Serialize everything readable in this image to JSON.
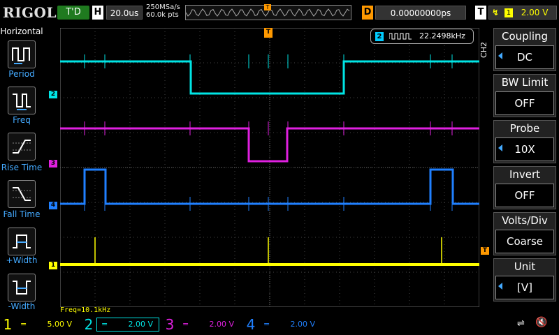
{
  "brand": "RIGOL",
  "top": {
    "trigger_status": "T'D",
    "h_label": "H",
    "timebase": "20.0us",
    "sample_rate": "250MSa/s",
    "mem_depth": "60.0k pts",
    "d_label": "D",
    "delay": "0.00000000ps",
    "t_label": "T",
    "trigger_edge_icon": "rising-edge-icon",
    "trigger_source": "1",
    "trigger_level": "2.00 V",
    "memory_marker": "T"
  },
  "left_panel": {
    "title": "Horizontal",
    "items": [
      {
        "label": "Period",
        "icon": "period-icon"
      },
      {
        "label": "Freq",
        "icon": "freq-icon"
      },
      {
        "label": "Rise Time",
        "icon": "rise-time-icon"
      },
      {
        "label": "Fall Time",
        "icon": "fall-time-icon"
      },
      {
        "label": "+Width",
        "icon": "pos-width-icon"
      },
      {
        "label": "-Width",
        "icon": "neg-width-icon"
      }
    ]
  },
  "measurement": {
    "channel": "2",
    "icon": "square-wave-icon",
    "value": "22.2498kHz"
  },
  "freq_readout": "Freq=10.1kHz",
  "channel_markers": [
    {
      "id": "2",
      "color": "#00e5e5"
    },
    {
      "id": "3",
      "color": "#e020e0"
    },
    {
      "id": "4",
      "color": "#2080ff"
    },
    {
      "id": "1",
      "color": "#ffff00"
    }
  ],
  "trigger_level_marker": "T",
  "right_panel": {
    "channel": "CH2",
    "menus": [
      {
        "title": "Coupling",
        "value": "DC"
      },
      {
        "title": "BW Limit",
        "value": "OFF"
      },
      {
        "title": "Probe",
        "value": "10X"
      },
      {
        "title": "Invert",
        "value": "OFF"
      },
      {
        "title": "Volts/Div",
        "value": "Coarse"
      },
      {
        "title": "Unit",
        "value": "[V]"
      }
    ]
  },
  "bottom": {
    "channels": [
      {
        "num": "1",
        "coupling": "=",
        "scale": "5.00 V",
        "color": "#ffff00"
      },
      {
        "num": "2",
        "coupling": "=",
        "scale": "2.00 V",
        "color": "#00e5e5"
      },
      {
        "num": "3",
        "coupling": "=",
        "scale": "2.00 V",
        "color": "#e020e0"
      },
      {
        "num": "4",
        "coupling": "=",
        "scale": "2.00 V",
        "color": "#2080ff"
      }
    ],
    "usb_icon": "usb-icon",
    "speaker_icon": "speaker-muted-icon"
  },
  "colors": {
    "ch1": "#ffff00",
    "ch2": "#00e5e5",
    "ch3": "#e020e0",
    "ch4": "#2080ff",
    "trigger": "#ff9900"
  }
}
